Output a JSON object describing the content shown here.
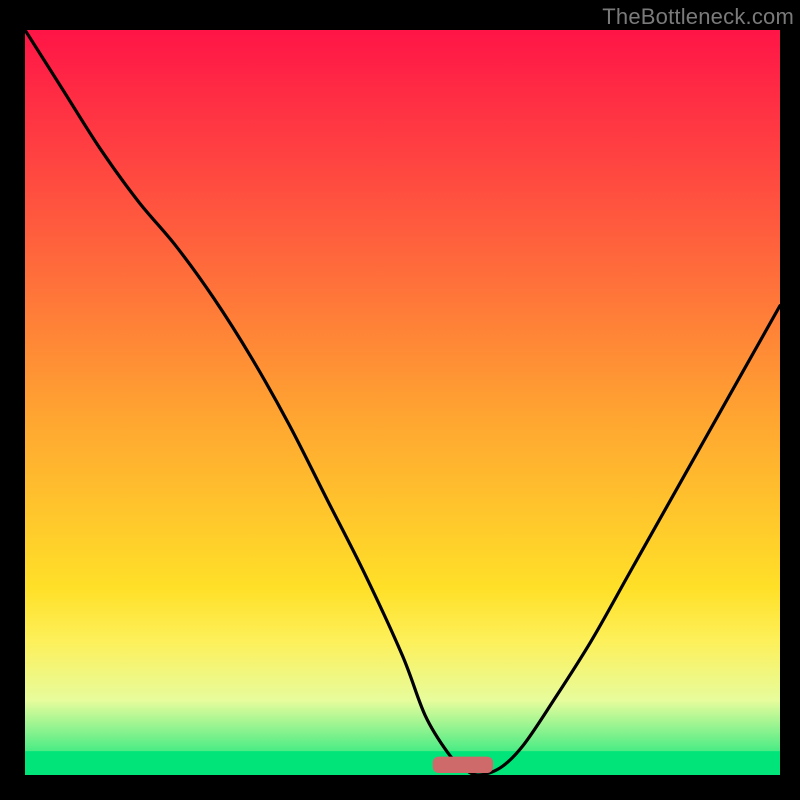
{
  "watermark": {
    "text": "TheBottleneck.com"
  },
  "gradient_colors": {
    "top": "#ff1547",
    "q1": "#ff5a3e",
    "mid": "#ffa531",
    "q3": "#ffe028",
    "ylw": "#fdf05a",
    "near": "#e7fc9c",
    "btm": "#00e47a"
  },
  "chart_data": {
    "type": "line",
    "title": "",
    "xlabel": "",
    "ylabel": "",
    "xlim": [
      0,
      100
    ],
    "ylim": [
      0,
      100
    ],
    "grid": false,
    "series": [
      {
        "name": "bottleneck-curve",
        "x": [
          0,
          5,
          10,
          15,
          20,
          25,
          30,
          35,
          40,
          45,
          50,
          53,
          56,
          58,
          60,
          63,
          66,
          70,
          75,
          80,
          85,
          90,
          95,
          100
        ],
        "values": [
          100,
          92,
          84,
          77,
          71,
          64,
          56,
          47,
          37,
          27,
          16,
          8,
          3,
          1,
          0,
          1,
          4,
          10,
          18,
          27,
          36,
          45,
          54,
          63
        ]
      }
    ],
    "marker": {
      "name": "optimal-range-marker",
      "x_center": 58,
      "width": 8,
      "height": 2.2,
      "color": "#cf6a6b"
    },
    "green_band": {
      "y_top_pct_from_bottom": 3.2,
      "color": "#00e47a"
    }
  }
}
